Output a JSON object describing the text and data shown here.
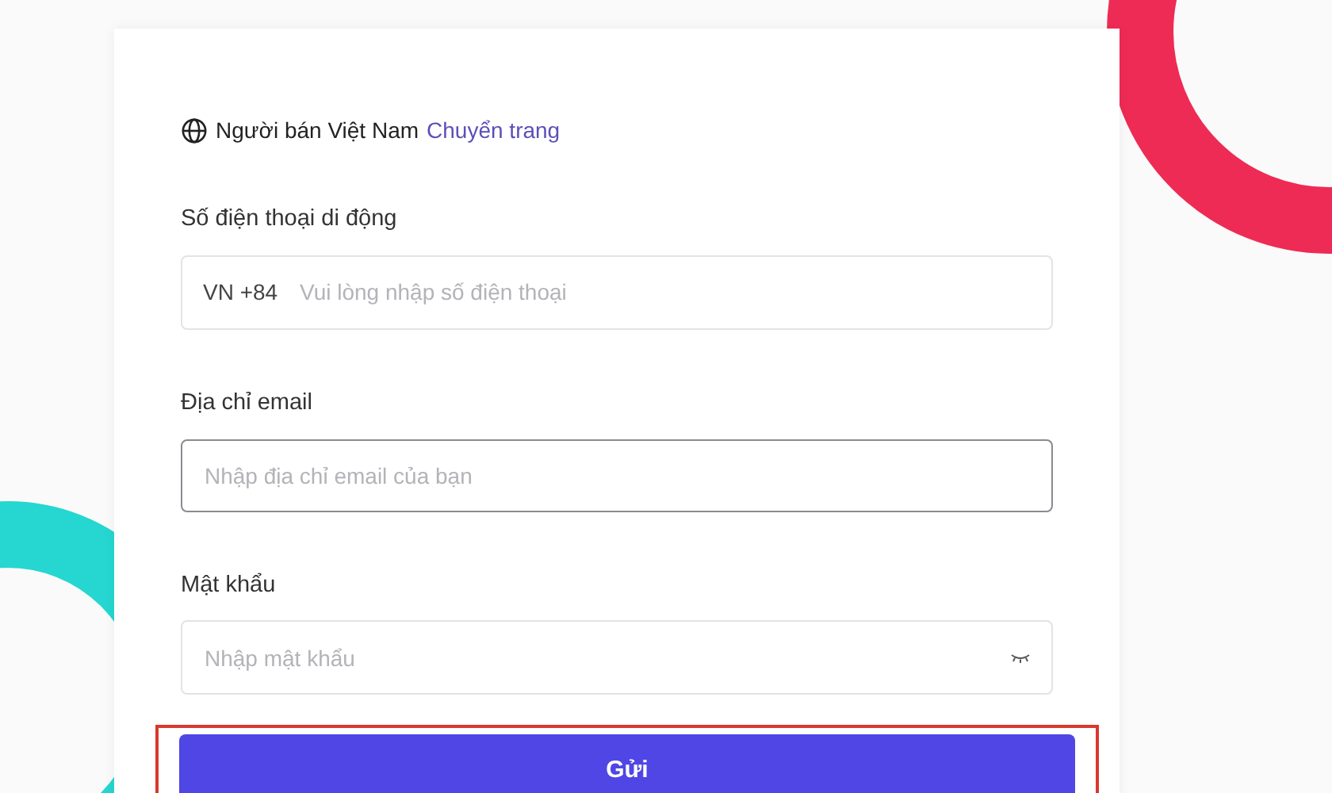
{
  "region": {
    "label": "Người bán Việt Nam",
    "link": "Chuyển trang"
  },
  "fields": [
    {
      "kind": "phone",
      "label": "Số điện thoại di động",
      "prefix": "VN +84",
      "placeholder": "Vui lòng nhập số điện thoại",
      "focused": false
    },
    {
      "kind": "email",
      "label": "Địa chỉ email",
      "placeholder": "Nhập địa chỉ email của bạn",
      "focused": true
    },
    {
      "kind": "password",
      "label": "Mật khẩu",
      "placeholder": "Nhập mật khẩu",
      "focused": false
    }
  ],
  "submit": {
    "label": "Gửi",
    "highlighted": true
  }
}
